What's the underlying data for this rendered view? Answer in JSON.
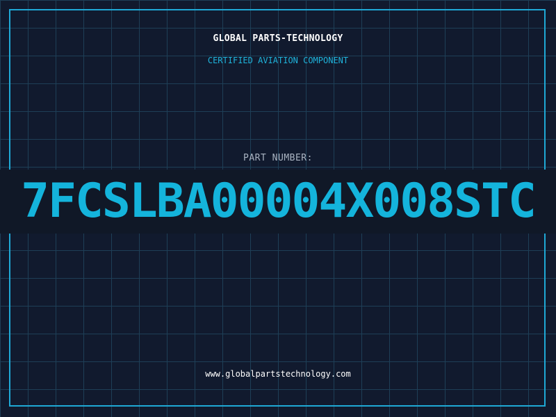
{
  "header": {
    "company": "GLOBAL PARTS-TECHNOLOGY",
    "subtitle": "CERTIFIED AVIATION COMPONENT"
  },
  "part": {
    "label": "PART NUMBER:",
    "number": "7FCSLBA00004X008STC"
  },
  "footer": {
    "website": "www.globalpartstechnology.com"
  },
  "colors": {
    "background": "#111a2e",
    "grid": "#1e3f57",
    "accent": "#1fa9d6",
    "band": "#101827"
  }
}
